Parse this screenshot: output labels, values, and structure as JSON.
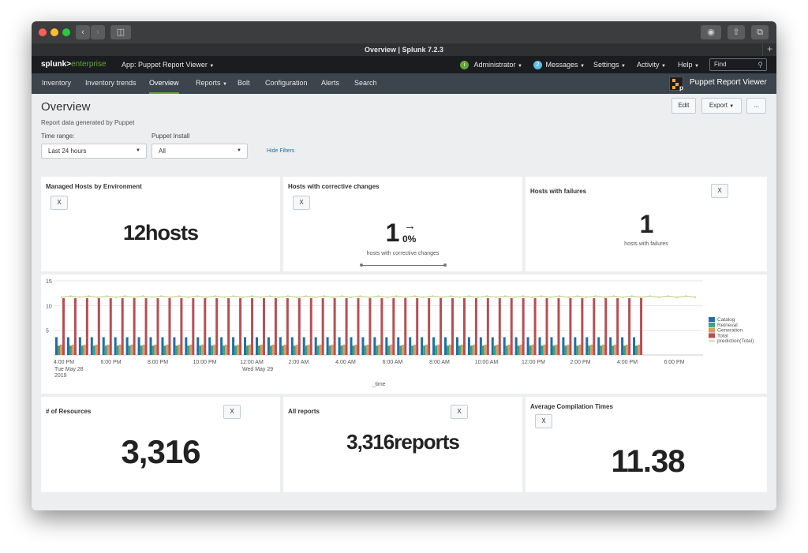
{
  "browser": {
    "tab_title": "Overview | Splunk 7.2.3",
    "new_tab": "+"
  },
  "splunkbar": {
    "logo_splunk": "splunk>",
    "logo_enterprise": "enterprise",
    "app_label": "App: Puppet Report Viewer",
    "admin_badge": "i",
    "administrator": "Administrator",
    "messages_count": "2",
    "messages": "Messages",
    "settings": "Settings",
    "activity": "Activity",
    "help": "Help",
    "find_placeholder": "Find"
  },
  "appbar": {
    "nav": [
      "Inventory",
      "Inventory trends",
      "Overview",
      "Reports",
      "Bolt",
      "Configuration",
      "Alerts",
      "Search"
    ],
    "active": "Overview",
    "app_title": "Puppet Report Viewer"
  },
  "header": {
    "title": "Overview",
    "description": "Report data generated by Puppet",
    "edit": "Edit",
    "export": "Export",
    "more": "..."
  },
  "filters": {
    "time_label": "Time range:",
    "time_value": "Last 24 hours",
    "install_label": "Puppet Install",
    "install_value": "All",
    "hide_filters": "Hide Filters"
  },
  "panels": {
    "managed": {
      "title": "Managed Hosts by Environment",
      "x": "X",
      "value": "12hosts"
    },
    "corrective": {
      "title": "Hosts with corrective changes",
      "x": "X",
      "value": "1",
      "arrow": "→",
      "pct": "0%",
      "caption": "hosts with corrective changes"
    },
    "failures": {
      "title": "Hosts with failures",
      "x": "X",
      "value": "1",
      "caption": "hosts with failures"
    },
    "resources": {
      "title": "# of Resources",
      "x": "X",
      "value": "3,316"
    },
    "reports": {
      "title": "All reports",
      "x": "X",
      "value": "3,316reports"
    },
    "compile": {
      "title": "Average Compilation Times",
      "x": "X",
      "value": "11.38"
    }
  },
  "chart_data": {
    "type": "bar",
    "xlabel": "_time",
    "ylim": [
      0,
      15
    ],
    "yticks": [
      "15",
      "10",
      "5"
    ],
    "xticks": [
      "4:00 PM",
      "6:00 PM",
      "8:00 PM",
      "10:00 PM",
      "12:00 AM",
      "2:00 AM",
      "4:00 AM",
      "6:00 AM",
      "8:00 AM",
      "10:00 AM",
      "12:00 PM",
      "2:00 PM",
      "4:00 PM",
      "6:00 PM"
    ],
    "xticks_sub": {
      "0": [
        "Tue May 28",
        "2019"
      ],
      "4": [
        "Wed May 29"
      ]
    },
    "groups": 50,
    "series": [
      {
        "name": "Catalog",
        "color": "#1e6fa8",
        "value": 3.6
      },
      {
        "name": "Retrieval",
        "color": "#3fa27e",
        "value": 1.9
      },
      {
        "name": "Generation",
        "color": "#de9a63",
        "value": 2.1
      },
      {
        "name": "Total",
        "color": "#b64f55",
        "value": 11.5
      },
      {
        "name": "prediction(Total)",
        "color": "#c5d48c",
        "value": 11.8
      }
    ],
    "legend_position": "right",
    "grid": true
  }
}
